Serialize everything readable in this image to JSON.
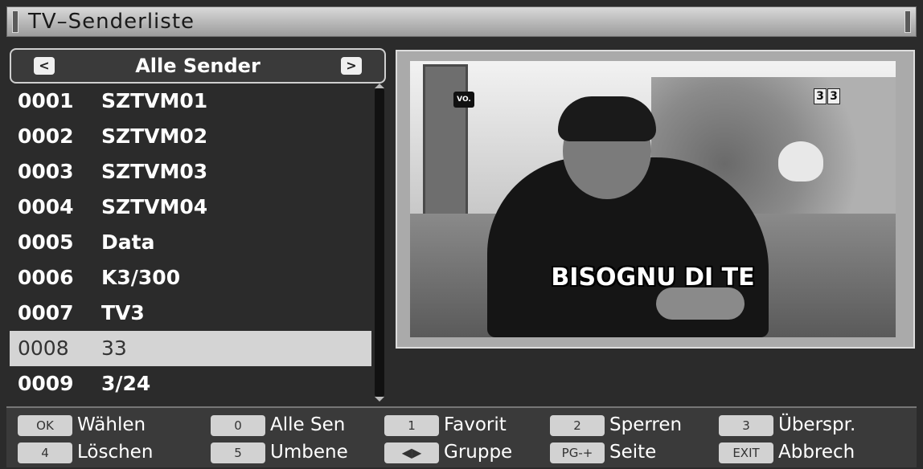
{
  "window": {
    "title": "TV–Senderliste"
  },
  "group": {
    "label": "Alle Sender",
    "prev_icon": "chevron-left-icon",
    "next_icon": "chevron-right-icon"
  },
  "channels": [
    {
      "num": "0001",
      "name": "SZTVM01"
    },
    {
      "num": "0002",
      "name": "SZTVM02"
    },
    {
      "num": "0003",
      "name": "SZTVM03"
    },
    {
      "num": "0004",
      "name": "SZTVM04"
    },
    {
      "num": "0005",
      "name": "Data"
    },
    {
      "num": "0006",
      "name": "K3/300"
    },
    {
      "num": "0007",
      "name": "TV3"
    },
    {
      "num": "0008",
      "name": "33"
    },
    {
      "num": "0009",
      "name": "3/24"
    }
  ],
  "selected_index": 7,
  "preview": {
    "subtitle": "BISOGNU DI TE",
    "vo_badge": "VO.",
    "channel_badge": [
      "3",
      "3"
    ]
  },
  "footer": {
    "hints": [
      {
        "key": "OK",
        "label": "Wählen"
      },
      {
        "key": "0",
        "label": "Alle Sen"
      },
      {
        "key": "1",
        "label": "Favorit"
      },
      {
        "key": "2",
        "label": "Sperren"
      },
      {
        "key": "3",
        "label": "Überspr."
      },
      {
        "key": "4",
        "label": "Löschen"
      },
      {
        "key": "5",
        "label": "Umbene"
      },
      {
        "key": "◀▶",
        "label": "Gruppe"
      },
      {
        "key": "PG-+",
        "label": "Seite"
      },
      {
        "key": "EXIT",
        "label": "Abbrech"
      }
    ]
  },
  "colors": {
    "selected_row": "#d4d4d4",
    "background": "#2b2b2b",
    "key_cap": "#d2d2d2"
  }
}
